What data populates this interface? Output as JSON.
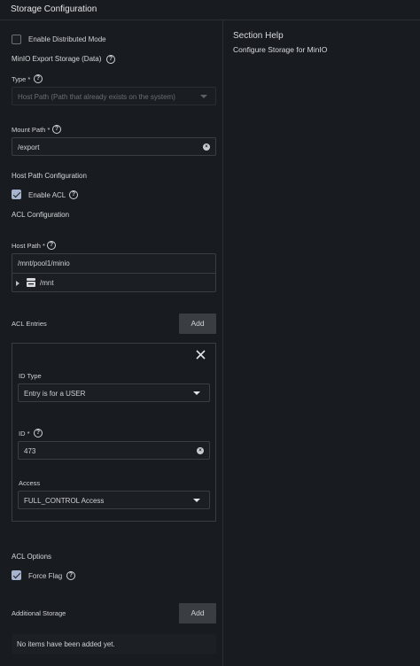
{
  "header": {
    "title": "Storage Configuration"
  },
  "help": {
    "title": "Section Help",
    "text": "Configure Storage for MinIO"
  },
  "distributed": {
    "label": "Enable Distributed Mode",
    "checked": false
  },
  "export_storage": {
    "heading": "MinIO Export Storage (Data)",
    "type_label": "Type *",
    "type_value": "Host Path (Path that already exists on the system)",
    "mount_label": "Mount Path *",
    "mount_value": "/export"
  },
  "host_path_config": {
    "heading": "Host Path Configuration",
    "acl_label": "Enable ACL",
    "acl_checked": true,
    "acl_config_heading": "ACL Configuration",
    "host_path_label": "Host Path *",
    "host_path_value": "/mnt/pool1/minio",
    "tree_node": "/mnt"
  },
  "acl_entries": {
    "label": "ACL Entries",
    "add_label": "Add",
    "id_type_label": "ID Type",
    "id_type_value": "Entry is for a USER",
    "id_label": "ID *",
    "id_value": "473",
    "access_label": "Access",
    "access_value": "FULL_CONTROL Access"
  },
  "acl_options": {
    "heading": "ACL Options",
    "force_label": "Force Flag",
    "force_checked": true
  },
  "additional_storage": {
    "label": "Additional Storage",
    "add_label": "Add",
    "empty_text": "No items have been added yet."
  },
  "icons": {
    "help": "help-circle-icon",
    "clear": "clear-circle-icon",
    "caret": "caret-down-icon",
    "close": "close-icon",
    "expand": "expand-arrow-icon",
    "drive": "dataset-drive-icon"
  }
}
